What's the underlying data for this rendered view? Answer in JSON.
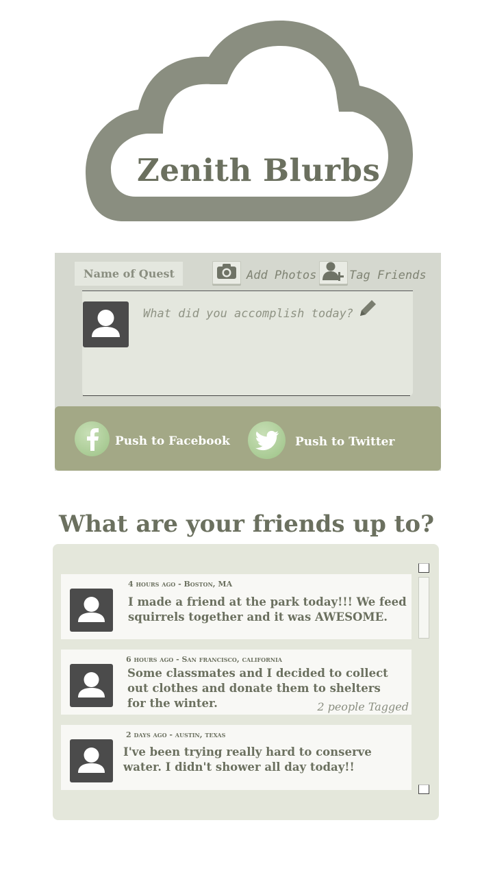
{
  "app": {
    "title": "Zenith Blurbs"
  },
  "composer": {
    "quest_name": "Name of Quest",
    "add_photos_label": "Add Photos",
    "tag_friends_label": "Tag Friends",
    "entry_placeholder": "What did you accomplish today?",
    "push_facebook_label": "Push to Facebook",
    "push_twitter_label": "Push to Twitter"
  },
  "friends": {
    "title": "What are your friends up to?",
    "posts": [
      {
        "meta": "4 hours ago - Boston, MA",
        "text": "I made a friend at the park today!!! We feed squirrels together and it was AWESOME.",
        "tagged": ""
      },
      {
        "meta": "6 hours ago - San francisco, california",
        "text": "Some classmates and I decided to collect out clothes and donate them to shelters for the winter.",
        "tagged": "2 people Tagged"
      },
      {
        "meta": "2 days ago - austin, texas",
        "text": "I've been trying really hard to conserve water. I didn't shower all day today!!",
        "tagged": ""
      }
    ]
  },
  "colors": {
    "logo_cloud": "#8a8e80",
    "heading_text": "#6b705f",
    "push_bar": "#a3a886",
    "avatar_bg": "#4b4b4b",
    "feed_bg": "#e4e7db"
  },
  "icons": [
    "cloud-logo",
    "camera-icon",
    "add-user-icon",
    "pencil-icon",
    "user-avatar-icon",
    "facebook-icon",
    "twitter-icon"
  ]
}
